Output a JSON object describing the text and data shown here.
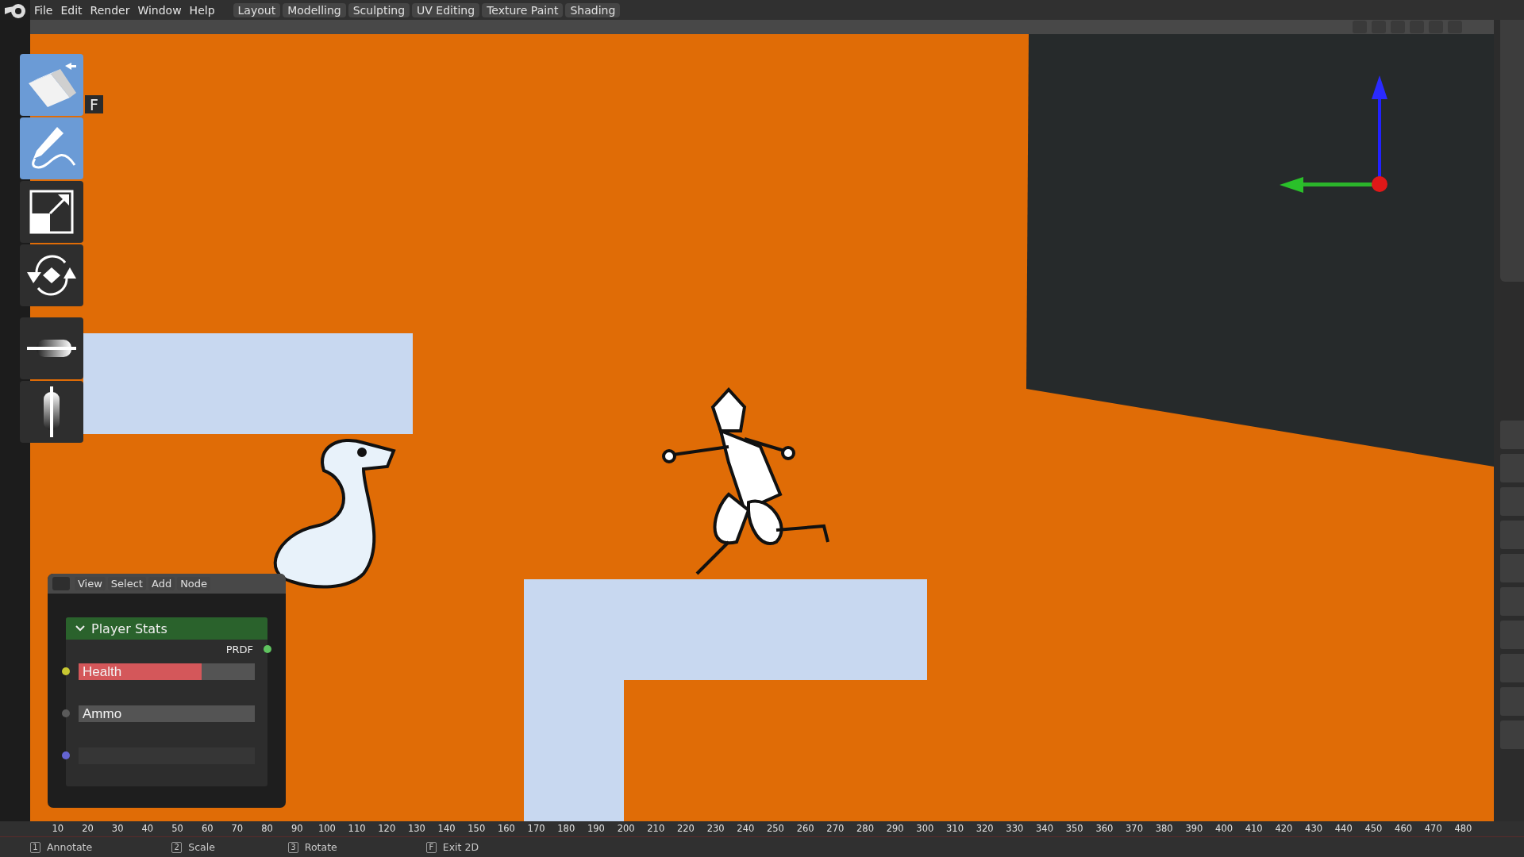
{
  "menu": [
    "File",
    "Edit",
    "Render",
    "Window",
    "Help"
  ],
  "workspaces": [
    "Layout",
    "Modelling",
    "Sculpting",
    "UV Editing",
    "Texture Paint",
    "Shading"
  ],
  "tool_groups": [
    [
      {
        "kind": "eraser",
        "selected": true,
        "shortcut": "F"
      },
      {
        "kind": "annotate",
        "selected": true
      },
      {
        "kind": "scale",
        "selected": false
      },
      {
        "kind": "rotate",
        "selected": false
      }
    ],
    [
      {
        "kind": "slider_h",
        "selected": false
      },
      {
        "kind": "slider_v",
        "selected": false
      }
    ]
  ],
  "node_editor": {
    "menu": [
      "View",
      "Select",
      "Add",
      "Node"
    ],
    "node": {
      "title": "Player Stats",
      "expanded": true,
      "output": {
        "label": "PRDF",
        "color": "#5fc35f"
      },
      "inputs": [
        {
          "kind": "slider",
          "label": "Health",
          "level": 0.7,
          "color": "#c8c832"
        },
        {
          "kind": "field",
          "label": "Ammo",
          "color": "#5a5a5a"
        },
        {
          "kind": "field",
          "color": "#6464d2"
        }
      ]
    }
  },
  "ruler": [
    "10",
    "20",
    "30",
    "40",
    "50",
    "60",
    "70",
    "80",
    "90",
    "100",
    "110",
    "120",
    "130",
    "140",
    "150",
    "160",
    "170",
    "180",
    "190",
    "200",
    "210",
    "220",
    "230",
    "240",
    "250",
    "260",
    "270",
    "280",
    "290",
    "300",
    "310",
    "320",
    "330",
    "340",
    "350",
    "360",
    "370",
    "380",
    "390",
    "400",
    "410",
    "420",
    "430",
    "440",
    "450",
    "460",
    "470",
    "480"
  ],
  "status": [
    {
      "key": "1",
      "label": "Annotate"
    },
    {
      "key": "2",
      "label": "Scale"
    },
    {
      "key": "3",
      "label": "Rotate"
    },
    {
      "key": "F",
      "label": "Exit 2D"
    }
  ]
}
